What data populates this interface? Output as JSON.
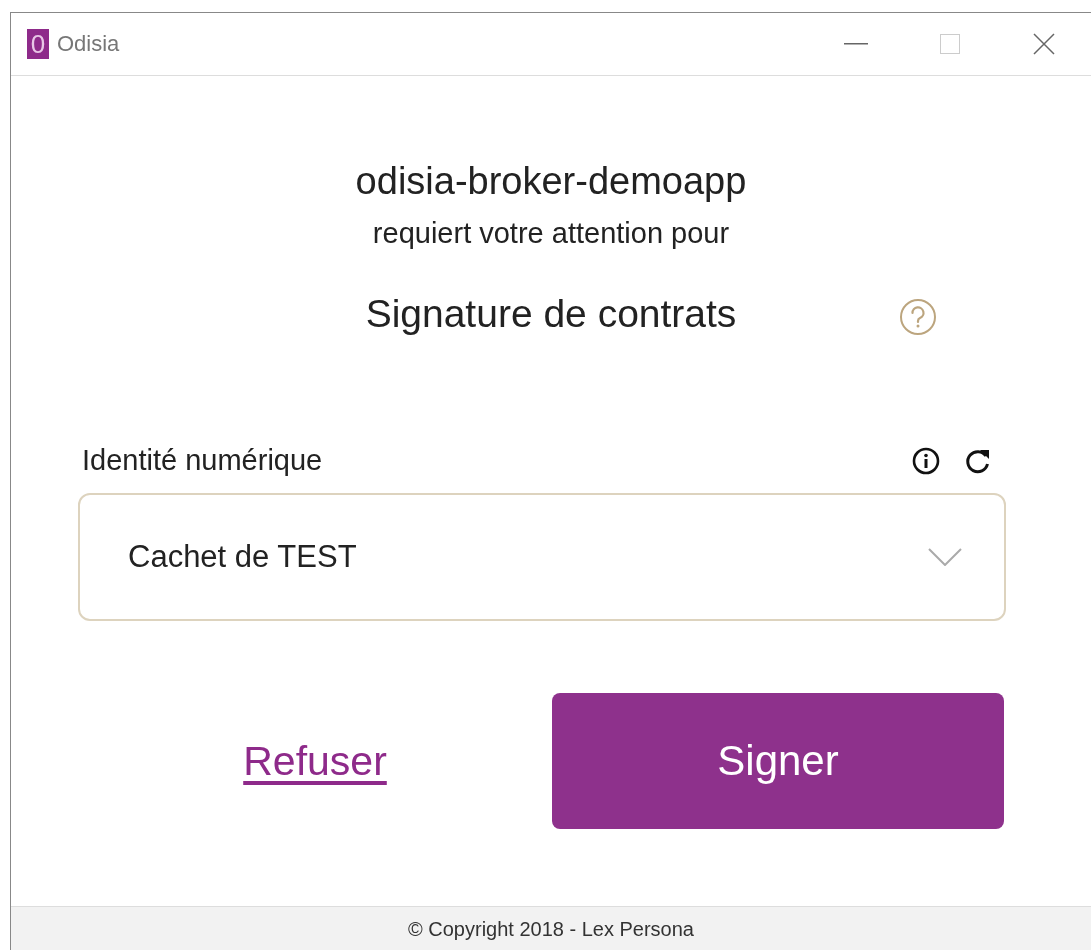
{
  "window": {
    "logo_letter": "0",
    "title": "Odisia"
  },
  "app_name": "odisia-broker-demoapp",
  "subtitle": "requiert votre attention pour",
  "purpose": "Signature de contrats",
  "identity": {
    "label": "Identité numérique",
    "value": "Cachet de TEST"
  },
  "buttons": {
    "refuse": "Refuser",
    "sign": "Signer"
  },
  "footer": "© Copyright 2018 - Lex Persona"
}
